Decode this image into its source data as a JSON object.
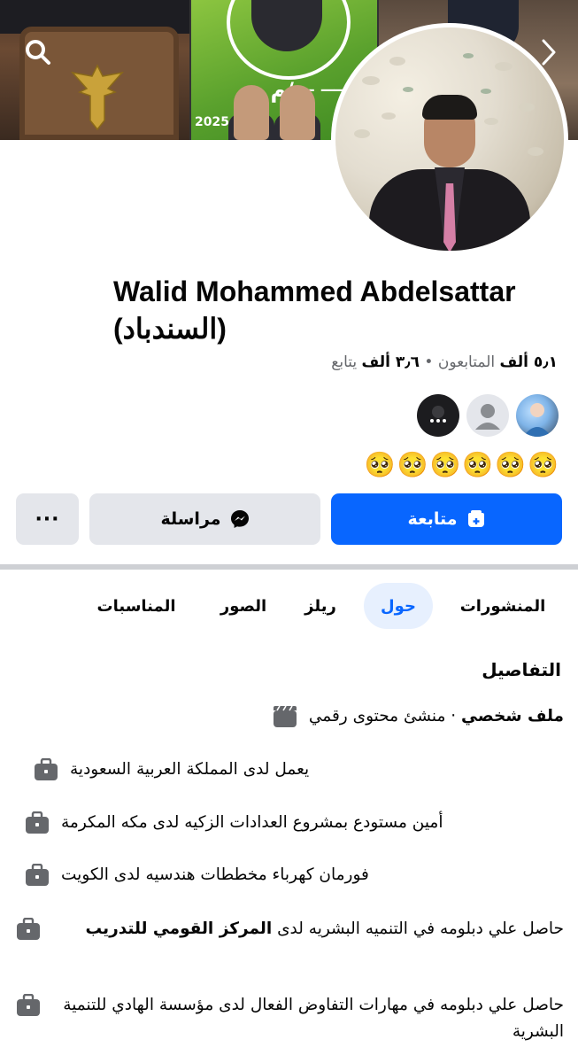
{
  "profile": {
    "name": "Walid Mohammed Abdelsattar (السندباد)",
    "followers_count": "٥٫١ ألف",
    "followers_label": "المتابعون",
    "following_count": "٣٫٦ ألف",
    "following_label": "يتابع",
    "stats_separator": "•",
    "bio": "🥺🥺🥺🥺🥺🥺"
  },
  "actions": {
    "follow_label": "متابعة",
    "message_label": "مراسلة",
    "more_label": "···"
  },
  "tabs": [
    {
      "label": "المنشورات",
      "active": false
    },
    {
      "label": "حول",
      "active": true
    },
    {
      "label": "ريلز",
      "active": false
    },
    {
      "label": "الصور",
      "active": false
    },
    {
      "label": "المناسبات",
      "active": false
    }
  ],
  "details": {
    "title": "التفاصيل",
    "profile_type_bold": "ملف شخصي",
    "profile_type_sep": " · ",
    "profile_type_rest": "منشئ محتوى رقمي",
    "items": [
      {
        "icon": "briefcase-icon",
        "text": "يعمل لدى المملكة العربية السعودية"
      },
      {
        "icon": "briefcase-icon",
        "text": "أمين مستودع بمشروع العدادات الزكيه لدى مكه المكرمة"
      },
      {
        "icon": "briefcase-icon",
        "text": "فورمان كهرباء مخططات هندسيه لدى الكويت"
      },
      {
        "icon": "briefcase-icon",
        "text_prefix": "حاصل علي دبلومه في التنميه البشريه لدى ",
        "text_bold": "المركز القومي للتدريب"
      },
      {
        "icon": "briefcase-icon",
        "text": "حاصل علي دبلومه في مهارات التفاوض الفعال لدى مؤسسة الهادي للتنمية البشرية"
      }
    ]
  },
  "colors": {
    "primary": "#0866ff",
    "secondary_button": "#e4e6eb",
    "active_tab_bg": "#e7f0fe",
    "muted_text": "#65676b"
  }
}
